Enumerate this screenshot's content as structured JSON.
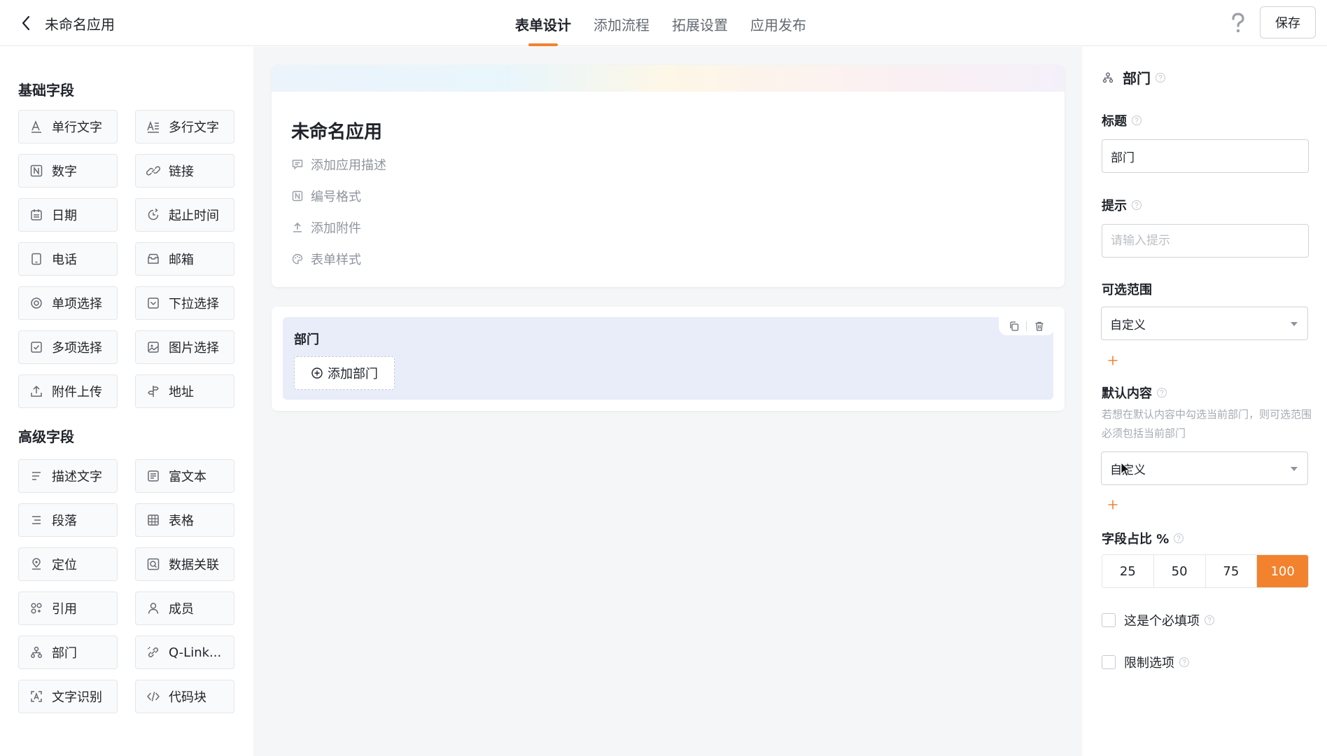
{
  "header": {
    "app_title": "未命名应用",
    "tabs": [
      {
        "label": "表单设计",
        "active": true
      },
      {
        "label": "添加流程",
        "active": false
      },
      {
        "label": "拓展设置",
        "active": false
      },
      {
        "label": "应用发布",
        "active": false
      }
    ],
    "save_label": "保存",
    "help_glyph": "?"
  },
  "left_panel": {
    "basic_title": "基础字段",
    "basic_fields": [
      {
        "label": "单行文字",
        "icon": "text-icon"
      },
      {
        "label": "多行文字",
        "icon": "multiline-text-icon"
      },
      {
        "label": "数字",
        "icon": "number-icon"
      },
      {
        "label": "链接",
        "icon": "link-icon"
      },
      {
        "label": "日期",
        "icon": "calendar-icon"
      },
      {
        "label": "起止时间",
        "icon": "time-range-icon"
      },
      {
        "label": "电话",
        "icon": "phone-icon"
      },
      {
        "label": "邮箱",
        "icon": "mail-icon"
      },
      {
        "label": "单项选择",
        "icon": "radio-icon"
      },
      {
        "label": "下拉选择",
        "icon": "dropdown-icon"
      },
      {
        "label": "多项选择",
        "icon": "checkbox-icon"
      },
      {
        "label": "图片选择",
        "icon": "image-icon"
      },
      {
        "label": "附件上传",
        "icon": "upload-icon"
      },
      {
        "label": "地址",
        "icon": "signpost-icon"
      }
    ],
    "advanced_title": "高级字段",
    "advanced_fields": [
      {
        "label": "描述文字",
        "icon": "description-icon"
      },
      {
        "label": "富文本",
        "icon": "rich-text-icon"
      },
      {
        "label": "段落",
        "icon": "paragraph-icon"
      },
      {
        "label": "表格",
        "icon": "table-icon"
      },
      {
        "label": "定位",
        "icon": "location-icon"
      },
      {
        "label": "数据关联",
        "icon": "data-link-icon"
      },
      {
        "label": "引用",
        "icon": "reference-icon"
      },
      {
        "label": "成员",
        "icon": "member-icon"
      },
      {
        "label": "部门",
        "icon": "department-icon"
      },
      {
        "label": "Q-Link...",
        "icon": "qlink-icon"
      },
      {
        "label": "文字识别",
        "icon": "ocr-icon"
      },
      {
        "label": "代码块",
        "icon": "code-icon"
      }
    ]
  },
  "canvas": {
    "form_title": "未命名应用",
    "meta_items": [
      {
        "label": "添加应用描述",
        "icon": "comment-icon"
      },
      {
        "label": "编号格式",
        "icon": "number-format-icon"
      },
      {
        "label": "添加附件",
        "icon": "attach-upload-icon"
      },
      {
        "label": "表单样式",
        "icon": "palette-icon"
      }
    ],
    "field": {
      "label": "部门",
      "add_button": "添加部门"
    }
  },
  "right_panel": {
    "header": "部门",
    "title_label": "标题",
    "title_value": "部门",
    "hint_label": "提示",
    "hint_placeholder": "请输入提示",
    "range_label": "可选范围",
    "range_value": "自定义",
    "default_label": "默认内容",
    "default_hint": "若想在默认内容中勾选当前部门，则可选范围必须包括当前部门",
    "default_value": "自定义",
    "ratio_label": "字段占比 %",
    "ratio_options": [
      "25",
      "50",
      "75",
      "100"
    ],
    "ratio_selected": "100",
    "required_label": "这是个必填项",
    "limit_label": "限制选项"
  },
  "colors": {
    "accent": "#f2822e",
    "selected_field_bg": "#e9edfa",
    "canvas_bg": "#f5f6f7"
  }
}
